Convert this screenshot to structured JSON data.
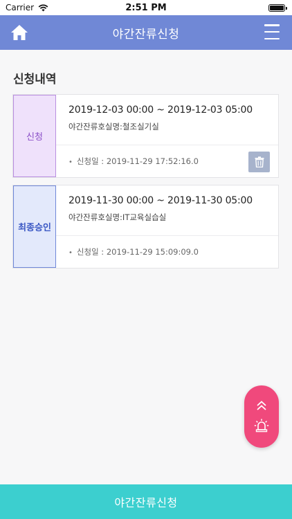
{
  "status_bar": {
    "carrier": "Carrier",
    "time": "2:51 PM"
  },
  "header": {
    "title": "야간잔류신청",
    "home_icon": "home-icon",
    "menu_icon": "hamburger-menu-icon",
    "color": "#7088d6"
  },
  "section_title": "신청내역",
  "requests": [
    {
      "status": "신청",
      "period": "2019-12-03 00:00 ~ 2019-12-03 05:00",
      "room": "야간잔류호실명:철조실기실",
      "applied": "신청일 : 2019-11-29 17:52:16.0",
      "bullet": "•",
      "status_color": "#8a4fc8"
    },
    {
      "status": "최종승인",
      "period": "2019-11-30 00:00 ~ 2019-11-30 05:00",
      "room": "야간잔류호실명:IT교육실습실",
      "applied": "신청일 : 2019-11-29 15:09:09.0",
      "bullet": "•",
      "status_color": "#3b58c4"
    }
  ],
  "fab": {
    "color": "#f0497c",
    "icons": [
      "double-chevron-up-icon",
      "siren-icon"
    ]
  },
  "bottom_button": {
    "label": "야간잔류신청",
    "color": "#3ccfcf"
  }
}
